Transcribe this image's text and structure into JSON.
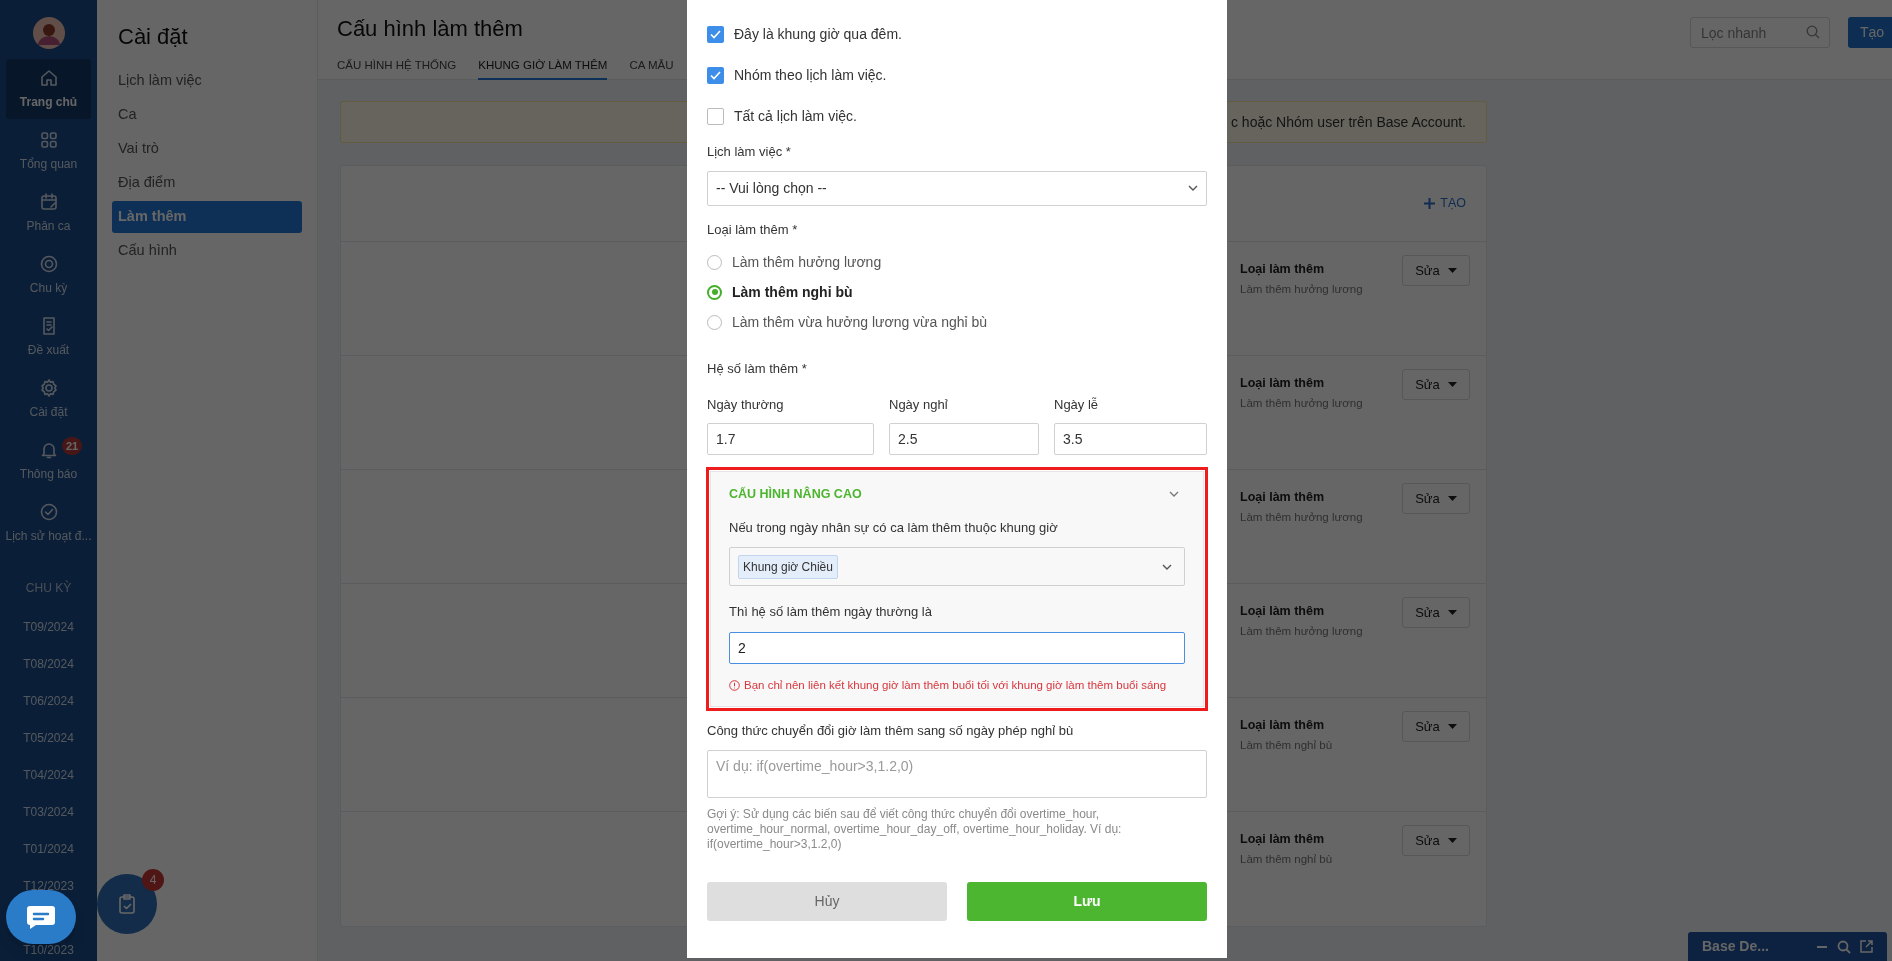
{
  "rail": {
    "items": [
      {
        "label": "Trang chủ",
        "selected": true
      },
      {
        "label": "Tổng quan",
        "selected": false
      },
      {
        "label": "Phân ca",
        "selected": false
      },
      {
        "label": "Chu kỳ",
        "selected": false
      },
      {
        "label": "Đề xuất",
        "selected": false
      },
      {
        "label": "Cài đặt",
        "selected": false
      },
      {
        "label": "Thông báo",
        "selected": false,
        "badge": "21"
      },
      {
        "label": "Lịch sử hoạt đ...",
        "selected": false
      }
    ],
    "section_title": "CHU KỲ",
    "periods": [
      "T09/2024",
      "T08/2024",
      "T06/2024",
      "T05/2024",
      "T04/2024",
      "T03/2024",
      "T01/2024",
      "T12/2023",
      "T10/2023"
    ]
  },
  "settings_menu": {
    "title": "Cài đặt",
    "items": [
      {
        "label": "Lịch làm việc",
        "selected": false
      },
      {
        "label": "Ca",
        "selected": false
      },
      {
        "label": "Vai trò",
        "selected": false
      },
      {
        "label": "Địa điểm",
        "selected": false
      },
      {
        "label": "Làm thêm",
        "selected": true
      },
      {
        "label": "Cấu hình",
        "selected": false
      }
    ]
  },
  "header": {
    "title": "Cấu hình làm thêm",
    "tabs": [
      {
        "label": "CẤU HÌNH HỆ THỐNG",
        "selected": false
      },
      {
        "label": "KHUNG GIỜ LÀM THÊM",
        "selected": true
      },
      {
        "label": "CA MẪU",
        "selected": false
      }
    ],
    "search": {
      "placeholder": "Lọc nhanh"
    },
    "create_button": "Tạo"
  },
  "notice": "c hoặc Nhóm user trên Base Account.",
  "list": {
    "create_link": "TẠO",
    "rows": [
      {
        "title": "Loại làm thêm",
        "subtitle": "Làm thêm hưởng lương",
        "action": "Sửa"
      },
      {
        "title": "Loại làm thêm",
        "subtitle": "Làm thêm hưởng lương",
        "action": "Sửa"
      },
      {
        "title": "Loại làm thêm",
        "subtitle": "Làm thêm hưởng lương",
        "action": "Sửa"
      },
      {
        "title": "Loại làm thêm",
        "subtitle": "Làm thêm hưởng lương",
        "action": "Sửa"
      },
      {
        "title": "Loại làm thêm",
        "subtitle": "Làm thêm nghỉ bù",
        "action": "Sửa"
      },
      {
        "title": "Loại làm thêm",
        "subtitle": "Làm thêm nghỉ bù",
        "action": "Sửa"
      }
    ]
  },
  "modal": {
    "checkboxes": [
      {
        "label": "Đây là khung giờ qua đêm.",
        "checked": true
      },
      {
        "label": "Nhóm theo lịch làm việc.",
        "checked": true
      },
      {
        "label": "Tất cả lịch làm việc.",
        "checked": false
      }
    ],
    "schedule": {
      "label": "Lịch làm việc *",
      "placeholder": "-- Vui lòng chọn --"
    },
    "overtime_type": {
      "label": "Loại làm thêm *",
      "options": [
        {
          "label": "Làm thêm hưởng lương",
          "selected": false
        },
        {
          "label": "Làm thêm nghỉ bù",
          "selected": true
        },
        {
          "label": "Làm thêm vừa hưởng lương vừa nghỉ bù",
          "selected": false
        }
      ]
    },
    "coefficients": {
      "label": "Hệ số làm thêm *",
      "fields": [
        {
          "label": "Ngày thường",
          "value": "1.7"
        },
        {
          "label": "Ngày nghỉ",
          "value": "2.5"
        },
        {
          "label": "Ngày lễ",
          "value": "3.5"
        }
      ]
    },
    "advanced": {
      "title": "CẤU HÌNH NÂNG CAO",
      "expanded": true,
      "condition_label": "Nếu trong ngày nhân sự có ca làm thêm thuộc khung giờ",
      "tags": [
        "Khung giờ Chiều"
      ],
      "value_label": "Thì hệ số làm thêm ngày thường là",
      "value": "2",
      "focused": true,
      "error": "Bạn chỉ nên liên kết khung giờ làm thêm buổi tối với khung giờ làm thêm buổi sáng"
    },
    "formula": {
      "label": "Công thức chuyển đổi giờ làm thêm sang số ngày phép nghỉ bù",
      "placeholder": "Ví dụ: if(overtime_hour>3,1.2,0)",
      "hint": "Gợi ý: Sử dụng các biến sau để viết công thức chuyển đổi overtime_hour, overtime_hour_normal, overtime_hour_day_off, overtime_hour_holiday. Ví dụ: if(overtime_hour>3,1.2,0)"
    },
    "buttons": {
      "cancel": "Hủy",
      "save": "Lưu"
    }
  },
  "floating": {
    "task_badge": "4"
  },
  "chat_bar": {
    "title": "Base De..."
  }
}
